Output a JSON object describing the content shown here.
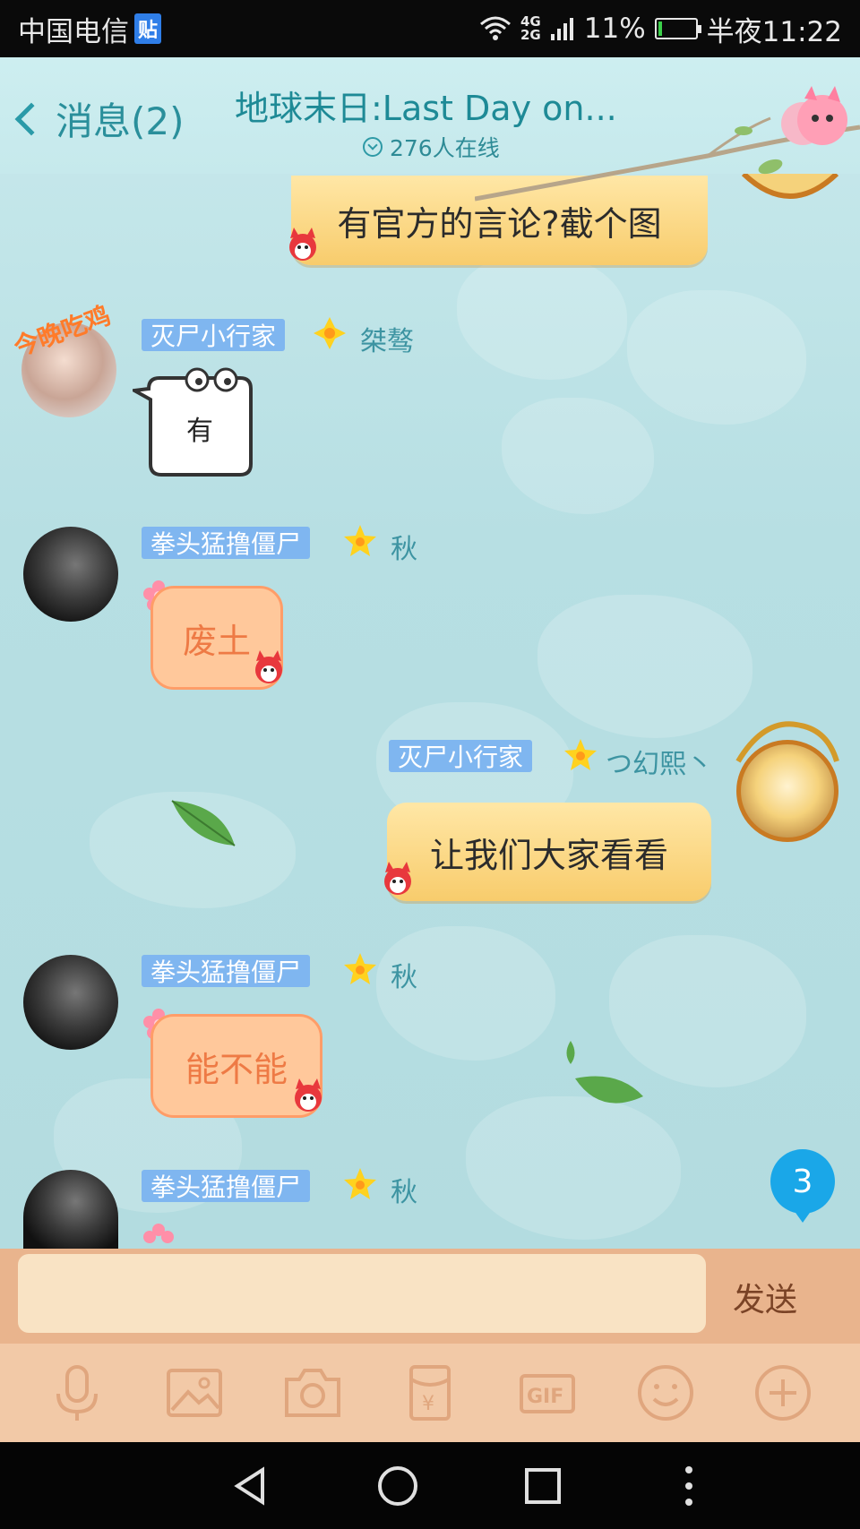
{
  "status_bar": {
    "carrier": "中国电信",
    "app_badge": "贴",
    "network_top": "4G",
    "network_bottom": "2G",
    "battery_percent": "11%",
    "battery_level": 0.11,
    "time": "半夜11:22"
  },
  "header": {
    "back_label": "消息(2)",
    "group_title": "地球末日:Last Day on...",
    "online_count": "276人在线"
  },
  "messages": [
    {
      "direction": "out",
      "text": "有官方的言论?截个图"
    },
    {
      "direction": "in",
      "sender": "灭尸小行家",
      "honor": "桀骜",
      "type": "sticker",
      "sticker_text": "有"
    },
    {
      "direction": "in",
      "sender": "拳头猛撸僵尸",
      "honor": "秋",
      "text": "废土"
    },
    {
      "direction": "out",
      "sender": "灭尸小行家",
      "honor": "つ幻熙丶",
      "text": "让我们大家看看"
    },
    {
      "direction": "in",
      "sender": "拳头猛撸僵尸",
      "honor": "秋",
      "text": "能不能"
    },
    {
      "direction": "in",
      "sender": "拳头猛撸僵尸",
      "honor": "秋",
      "text": ""
    }
  ],
  "unread_count": "3",
  "input": {
    "placeholder": "",
    "send_label": "发送"
  },
  "toolbar": [
    "mic-icon",
    "image-icon",
    "camera-icon",
    "red-packet-icon",
    "gif-icon",
    "emoji-icon",
    "plus-icon"
  ],
  "toolbar_gif_label": "GIF",
  "colors": {
    "accent": "#2a8f9b",
    "name_tag": "#7fb6f0",
    "bubble_out": "#f8cc6c",
    "bubble_in": "#ffc89b",
    "badge": "#1aa7e8"
  }
}
